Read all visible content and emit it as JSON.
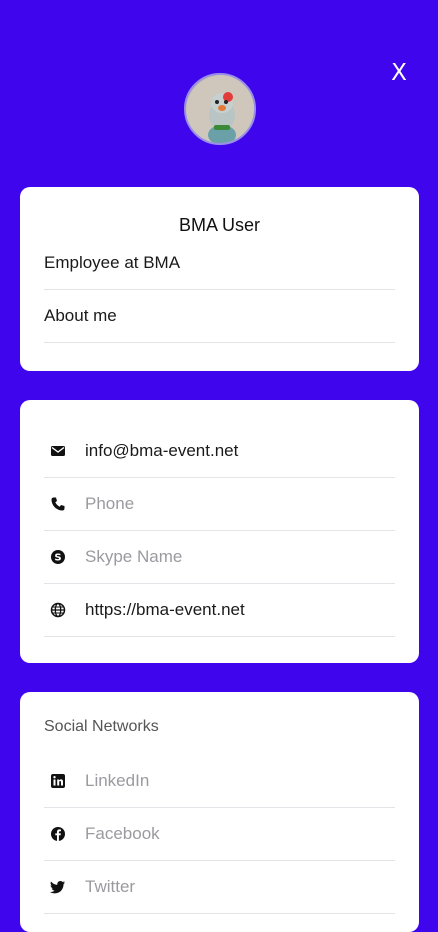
{
  "header": {
    "close_label": "X"
  },
  "profile": {
    "name": "BMA User",
    "title": "Employee at BMA",
    "about_label": "About me"
  },
  "contact": {
    "email": "info@bma-event.net",
    "phone_placeholder": "Phone",
    "skype_placeholder": "Skype Name",
    "website": "https://bma-event.net"
  },
  "social": {
    "section_title": "Social Networks",
    "items": [
      {
        "label": "LinkedIn",
        "icon": "linkedin-icon"
      },
      {
        "label": "Facebook",
        "icon": "facebook-icon"
      },
      {
        "label": "Twitter",
        "icon": "twitter-icon"
      }
    ]
  },
  "colors": {
    "background": "#3f06ee",
    "card": "#ffffff",
    "placeholder_text": "#9a9aa0"
  }
}
